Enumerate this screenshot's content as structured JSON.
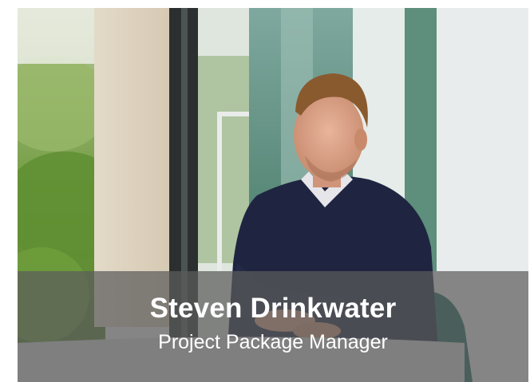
{
  "profile": {
    "name": "Steven Drinkwater",
    "title": "Project Package Manager"
  },
  "colors": {
    "caption_overlay": "#5c5c5c",
    "text": "#ffffff"
  }
}
